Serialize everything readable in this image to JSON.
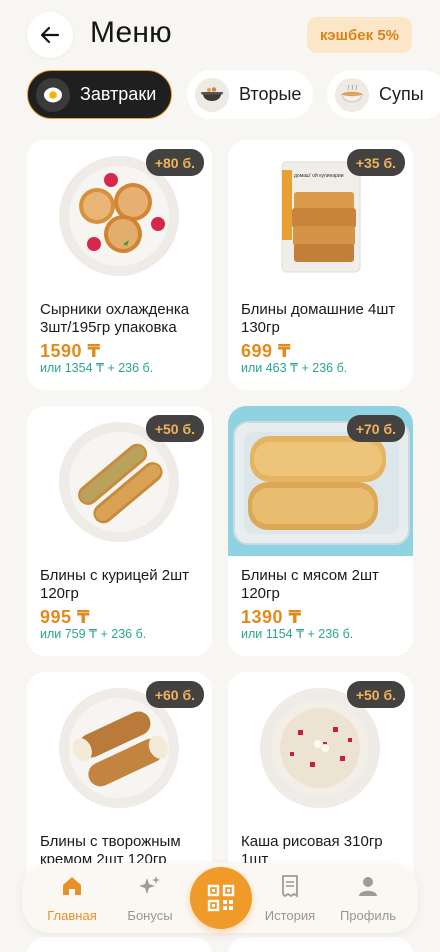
{
  "header": {
    "title": "Меню",
    "cashback": "кэшбек 5%"
  },
  "tabs": [
    {
      "label": "Завтраки",
      "icon": "egg-icon",
      "active": true
    },
    {
      "label": "Вторые",
      "icon": "pan-icon",
      "active": false
    },
    {
      "label": "Супы",
      "icon": "soup-bowl-icon",
      "active": false
    }
  ],
  "products": [
    {
      "name": "Сырники охлажденка 3шт/195гр упаковка",
      "price": "1590 ₸",
      "alt": "или 1354 ₸ + 236 б.",
      "bonus": "+80 б."
    },
    {
      "name": "Блины домашние 4шт 130гр",
      "price": "699 ₸",
      "alt": "или 463 ₸ + 236 б.",
      "bonus": "+35 б."
    },
    {
      "name": "Блины с курицей 2шт 120гр",
      "price": "995 ₸",
      "alt": "или 759 ₸ + 236 б.",
      "bonus": "+50 б."
    },
    {
      "name": "Блины с мясом 2шт 120гр",
      "price": "1390 ₸",
      "alt": "или 1154 ₸ + 236 б.",
      "bonus": "+70 б."
    },
    {
      "name": "Блины с творожным кремом 2шт 120гр",
      "price": "",
      "alt": "",
      "bonus": "+60 б."
    },
    {
      "name": "Каша рисовая 310гр 1шт",
      "price": "",
      "alt": "",
      "bonus": "+50 б."
    }
  ],
  "package_label": "домаш' ой кулинарии",
  "bottom_nav": {
    "home": "Главная",
    "bonuses": "Бонусы",
    "history": "История",
    "profile": "Профиль"
  },
  "colors": {
    "accent": "#e8902a",
    "price": "#e28a1a",
    "alt_price": "#2aa58f",
    "badge_bg": "#444241"
  }
}
